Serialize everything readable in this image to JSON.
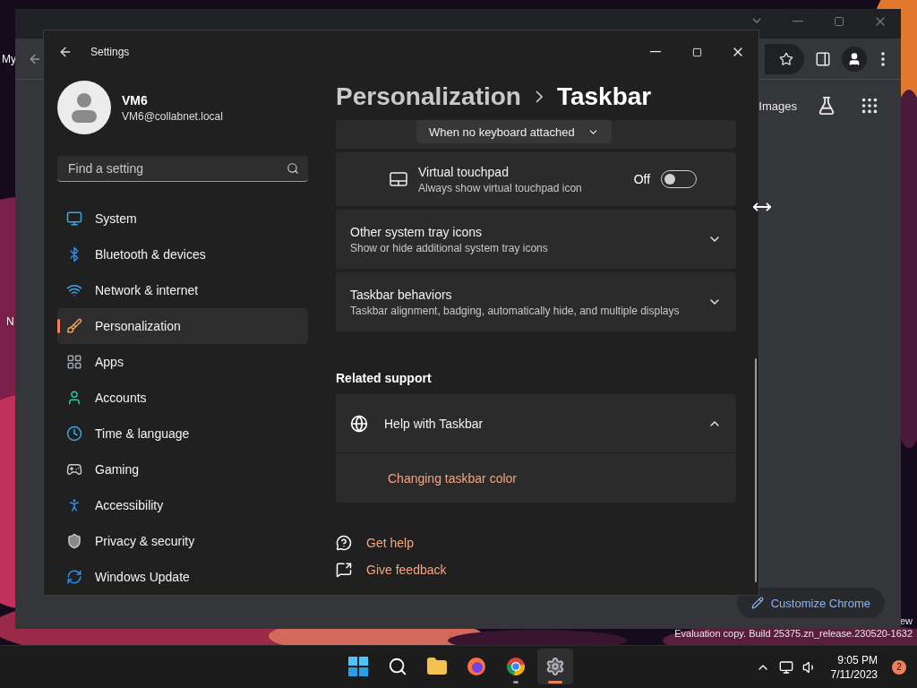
{
  "desktop": {
    "icons": [
      {
        "label": "My"
      },
      {
        "label": "N"
      }
    ],
    "watermark": [
      "ew",
      "Evaluation copy. Build 25375.zn_release.230520-1632"
    ]
  },
  "chrome": {
    "links": [
      {
        "label": "Images"
      }
    ],
    "customize_button": "Customize Chrome"
  },
  "settings": {
    "title": "Settings",
    "profile": {
      "name": "VM6",
      "email": "VM6@collabnet.local"
    },
    "search": {
      "placeholder": "Find a setting"
    },
    "nav": [
      {
        "label": "System",
        "kind": "system",
        "selected": false
      },
      {
        "label": "Bluetooth & devices",
        "kind": "bluetooth",
        "selected": false
      },
      {
        "label": "Network & internet",
        "kind": "network",
        "selected": false
      },
      {
        "label": "Personalization",
        "kind": "personalization",
        "selected": true
      },
      {
        "label": "Apps",
        "kind": "apps",
        "selected": false
      },
      {
        "label": "Accounts",
        "kind": "accounts",
        "selected": false
      },
      {
        "label": "Time & language",
        "kind": "time",
        "selected": false
      },
      {
        "label": "Gaming",
        "kind": "gaming",
        "selected": false
      },
      {
        "label": "Accessibility",
        "kind": "accessibility",
        "selected": false
      },
      {
        "label": "Privacy & security",
        "kind": "privacy",
        "selected": false
      },
      {
        "label": "Windows Update",
        "kind": "update",
        "selected": false
      }
    ],
    "breadcrumb": [
      "Personalization",
      "Taskbar"
    ],
    "dropdown": {
      "value": "When no keyboard attached"
    },
    "toggle_row": {
      "title": "Virtual touchpad",
      "subtitle": "Always show virtual touchpad icon",
      "state_label": "Off",
      "on": false
    },
    "expanders": [
      {
        "title": "Other system tray icons",
        "subtitle": "Show or hide additional system tray icons",
        "expanded": false
      },
      {
        "title": "Taskbar behaviors",
        "subtitle": "Taskbar alignment, badging, automatically hide, and multiple displays",
        "expanded": false
      }
    ],
    "related_heading": "Related support",
    "help": {
      "title": "Help with Taskbar",
      "expanded": true,
      "links": [
        "Changing taskbar color"
      ]
    },
    "footer_links": [
      {
        "label": "Get help",
        "kind": "help"
      },
      {
        "label": "Give feedback",
        "kind": "feedback"
      }
    ]
  },
  "taskbar": {
    "apps": [
      {
        "kind": "start",
        "running": false,
        "selected": false
      },
      {
        "kind": "search",
        "running": false,
        "selected": false
      },
      {
        "kind": "explorer",
        "running": false,
        "selected": false
      },
      {
        "kind": "firefox",
        "running": false,
        "selected": false
      },
      {
        "kind": "chrome",
        "running": true,
        "selected": false
      },
      {
        "kind": "settings",
        "running": true,
        "selected": true
      }
    ],
    "time": "9:05 PM",
    "date": "7/11/2023",
    "notifications": "2"
  }
}
